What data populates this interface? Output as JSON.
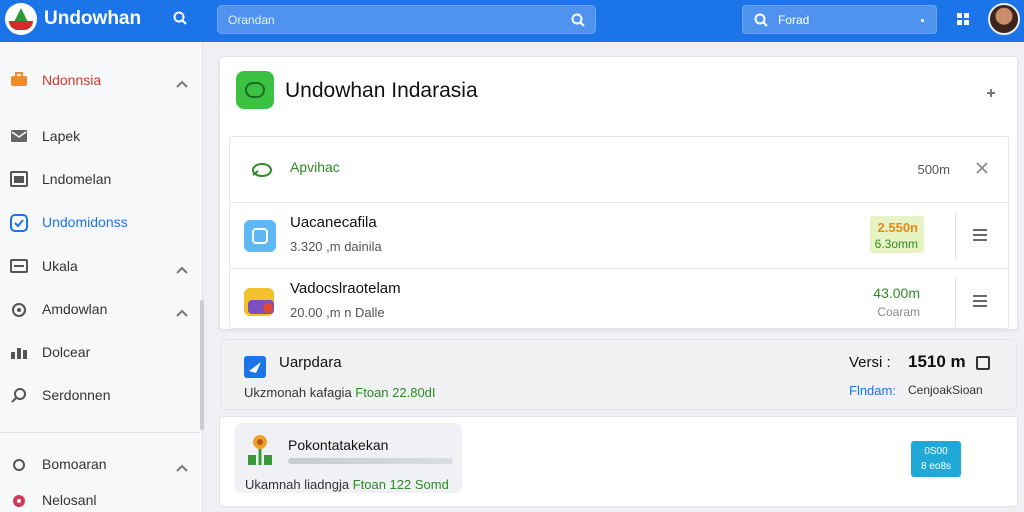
{
  "app": {
    "title": "Undowhan"
  },
  "search_main": {
    "placeholder": "Orandan"
  },
  "search_side": {
    "placeholder": "Forad"
  },
  "sidebar": {
    "items": [
      {
        "label": "Ndonnsia",
        "icon": "toolbox-icon"
      },
      {
        "label": "Lapek",
        "icon": "mail-icon"
      },
      {
        "label": "Lndomelan",
        "icon": "window-icon"
      },
      {
        "label": "Undomidonss",
        "icon": "check-icon"
      },
      {
        "label": "Ukala",
        "icon": "list-icon"
      },
      {
        "label": "Amdowlan",
        "icon": "gear-icon"
      },
      {
        "label": "Dolcear",
        "icon": "chart-icon"
      },
      {
        "label": "Serdonnen",
        "icon": "search-icon"
      },
      {
        "label": "Bomoaran",
        "icon": "circle-icon"
      },
      {
        "label": "Nelosanl",
        "icon": "pin-icon"
      }
    ]
  },
  "card": {
    "title": "Undowhan Indarasia",
    "rows": [
      {
        "title": "Apvihac",
        "value": "500m"
      },
      {
        "title": "Uacanecafila",
        "subtitle": "3.320 ,m dainila",
        "value_primary": "2.550n",
        "value_secondary": "6.3omm"
      },
      {
        "title": "Vadocslraotelam",
        "subtitle": "20.00 ,m n Dalle",
        "value_primary": "43.00m",
        "value_secondary": "Coaram"
      }
    ]
  },
  "panel2": {
    "title": "Uarpdara",
    "subtitle": "Ukzmonah kafagia",
    "subtitle_green": "Ftoan 22.80dI",
    "version_label": "Versi :",
    "version_value": "1510 m",
    "link": "Flndam:",
    "extra": "CenjoakSioan"
  },
  "panel3": {
    "title": "Pokontatakekan",
    "subtitle": "Ukamnah liadngja",
    "subtitle_green": "Ftoan 122 Somd",
    "badge_line1": "0S00",
    "badge_line2": "8 eo8s"
  },
  "colors": {
    "primary": "#1b74e8",
    "green": "#2d8a25",
    "accent_red": "#d03a2a",
    "badge_blue": "#20a9d6"
  }
}
